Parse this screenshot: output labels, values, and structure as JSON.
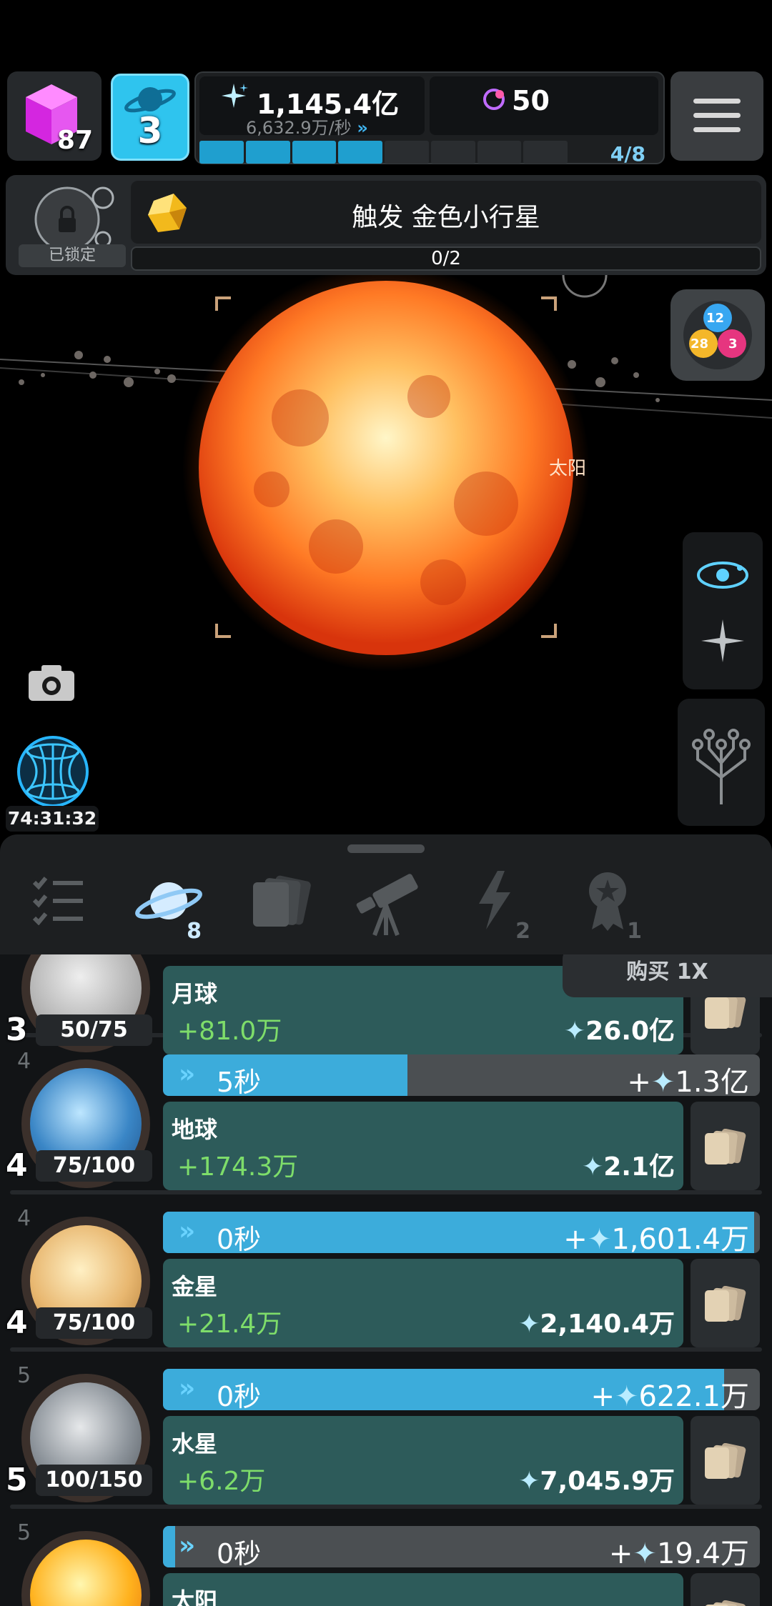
{
  "header": {
    "gem_count": "87",
    "level": "3",
    "stardust": "1,145.4亿",
    "stardust_rate": "6,632.9万/秒",
    "dark_matter": "50",
    "progress_text": "4/8",
    "progress_segments_total": 8,
    "progress_segments_filled": 4
  },
  "mission": {
    "locked_label": "已锁定",
    "title": "触发 金色小行星",
    "progress": "0/2"
  },
  "scene": {
    "sun_label": "太阳",
    "cluster_counts": [
      "12",
      "28",
      "3"
    ],
    "timer": "74:31:32"
  },
  "tabs": [
    {
      "name": "tasks",
      "badge": ""
    },
    {
      "name": "planets",
      "badge": "8"
    },
    {
      "name": "cards",
      "badge": ""
    },
    {
      "name": "telescope",
      "badge": ""
    },
    {
      "name": "boosts",
      "badge": "2"
    },
    {
      "name": "achievements",
      "badge": "1"
    }
  ],
  "list": {
    "buy_multiplier": "购买 1X",
    "rows": [
      {
        "tier": "",
        "name": "月球",
        "level": "3",
        "count": "50/75",
        "income": "+81.0万",
        "cost": "26.0亿",
        "timer": "",
        "reward": "",
        "fill": 0
      },
      {
        "tier": "4",
        "name": "地球",
        "level": "4",
        "count": "75/100",
        "income": "+174.3万",
        "cost": "2.1亿",
        "timer": "5秒",
        "reward": "1.3亿",
        "fill": 0.41
      },
      {
        "tier": "4",
        "name": "金星",
        "level": "4",
        "count": "75/100",
        "income": "+21.4万",
        "cost": "2,140.4万",
        "timer": "0秒",
        "reward": "1,601.4万",
        "fill": 0.99
      },
      {
        "tier": "5",
        "name": "水星",
        "level": "5",
        "count": "100/150",
        "income": "+6.2万",
        "cost": "7,045.9万",
        "timer": "0秒",
        "reward": "622.1万",
        "fill": 0.94
      },
      {
        "tier": "5",
        "name": "太阳",
        "level": "",
        "count": "",
        "income": "",
        "cost": "",
        "timer": "0秒",
        "reward": "19.4万",
        "fill": 0.02
      }
    ]
  }
}
